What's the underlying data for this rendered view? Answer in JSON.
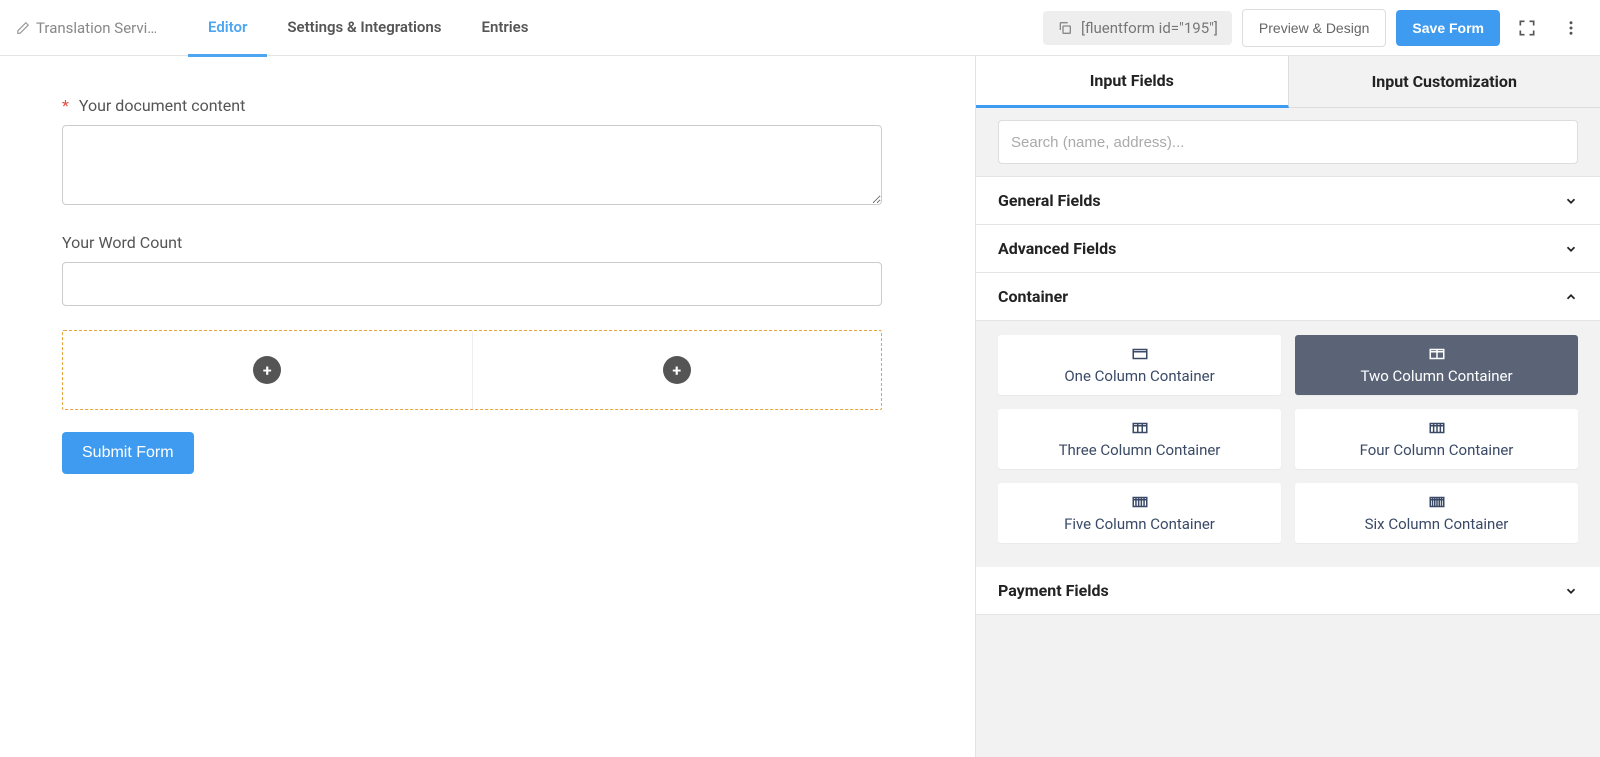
{
  "header": {
    "form_title": "Translation Servi…",
    "tabs": {
      "editor": "Editor",
      "settings": "Settings & Integrations",
      "entries": "Entries"
    },
    "shortcode": "[fluentform id=\"195\"]",
    "preview_btn": "Preview & Design",
    "save_btn": "Save Form"
  },
  "form": {
    "doc_label": "Your document content",
    "wordcount_label": "Your Word Count",
    "submit_label": "Submit Form"
  },
  "sidebar": {
    "tabs": {
      "input_fields": "Input Fields",
      "customization": "Input Customization"
    },
    "search_placeholder": "Search (name, address)...",
    "sections": {
      "general": "General Fields",
      "advanced": "Advanced Fields",
      "container": "Container",
      "payment": "Payment Fields"
    },
    "container_items": {
      "one": "One Column Container",
      "two": "Two Column Container",
      "three": "Three Column Container",
      "four": "Four Column Container",
      "five": "Five Column Container",
      "six": "Six Column Container"
    }
  }
}
